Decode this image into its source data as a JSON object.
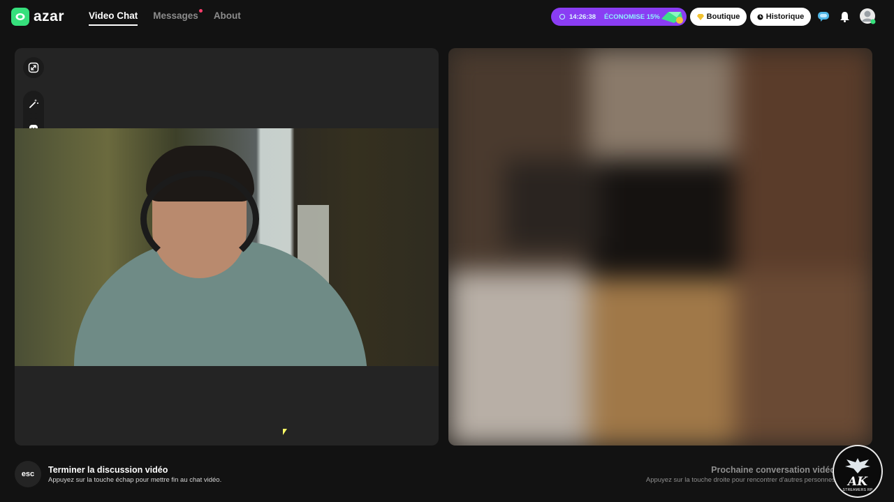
{
  "header": {
    "logo_text": "azar",
    "nav": [
      {
        "label": "Video Chat",
        "active": true
      },
      {
        "label": "Messages",
        "has_notification": true
      },
      {
        "label": "About"
      }
    ],
    "promo": {
      "timer": "14:26:38",
      "label": "ÉCONOMISE 15%"
    },
    "boutique_label": "Boutique",
    "historique_label": "Historique"
  },
  "footer": {
    "esc_key": "esc",
    "end_title": "Terminer la discussion vidéo",
    "end_hint": "Appuyez sur la touche échap pour mettre fin au chat vidéo.",
    "next_title": "Prochaine conversation vidéo",
    "next_hint": "Appuyez sur la touche droite pour rencontrer d'autres personnes"
  },
  "badge": {
    "big": "AK",
    "small": "STREAMERS RP"
  },
  "colors": {
    "brand": "#36e07c",
    "promo": "#8a3df3",
    "notification": "#ff3e6c"
  }
}
